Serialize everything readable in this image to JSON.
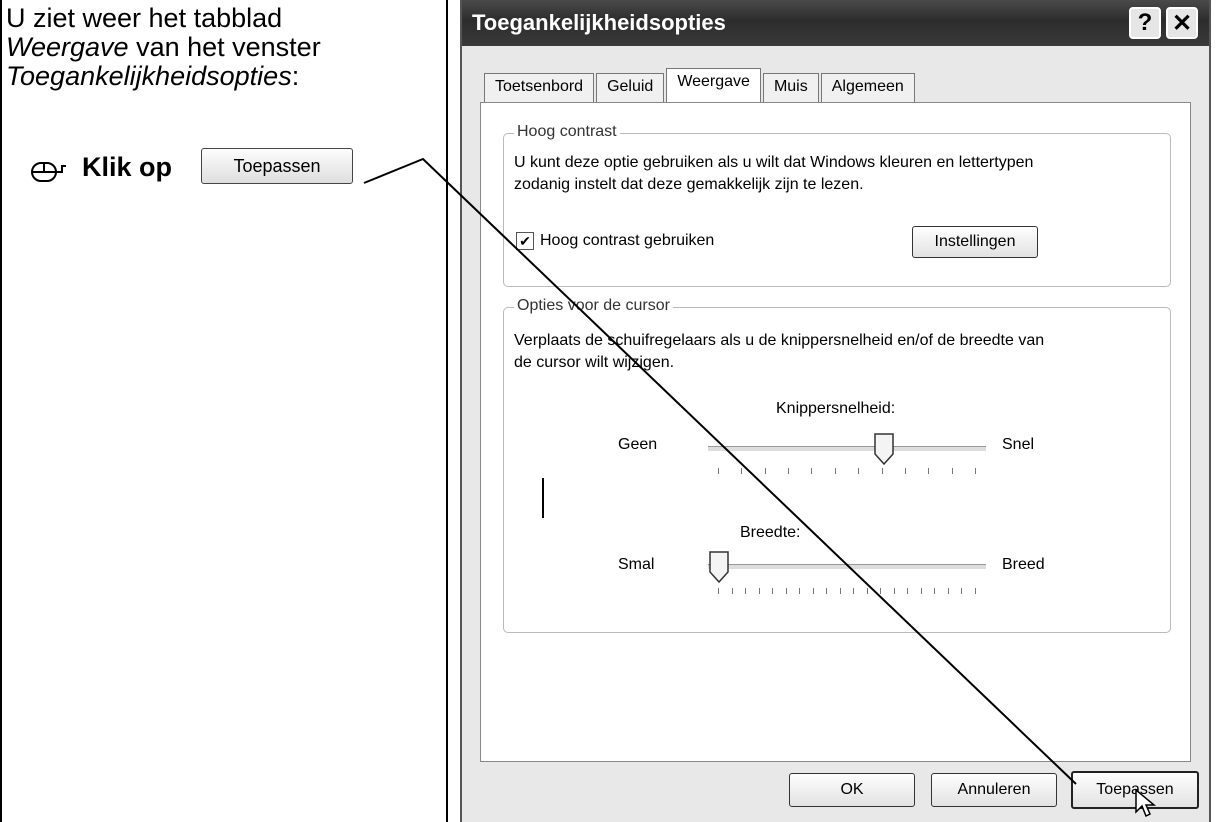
{
  "instruction": {
    "line1": "U ziet weer het tabblad",
    "line2_italic": "Weergave",
    "line2_rest": " van het venster",
    "line3_italic": "Toegankelijkheidsopties",
    "line3_rest": ":",
    "action_label": "Klik op",
    "action_button": "Toepassen"
  },
  "dialog": {
    "title": "Toegankelijkheidsopties",
    "help_glyph": "?",
    "close_glyph": "✕",
    "tabs": [
      "Toetsenbord",
      "Geluid",
      "Weergave",
      "Muis",
      "Algemeen"
    ],
    "active_tab": "Weergave",
    "high_contrast": {
      "legend": "Hoog contrast",
      "desc1": "U kunt deze optie gebruiken als u wilt dat Windows kleuren en lettertypen",
      "desc2": "zodanig instelt dat deze gemakkelijk zijn te lezen.",
      "checkbox_label": "Hoog contrast gebruiken",
      "checked": true,
      "settings_button": "Instellingen"
    },
    "cursor": {
      "legend": "Opties voor de cursor",
      "desc1": "Verplaats de schuifregelaars als u de knippersnelheid en/of de breedte van",
      "desc2": "de cursor wilt wijzigen.",
      "blink_label": "Knippersnelheid:",
      "blink_min": "Geen",
      "blink_max": "Snel",
      "blink_level": 0.64,
      "width_label": "Breedte:",
      "width_min": "Smal",
      "width_max": "Breed",
      "width_level": 0.0
    },
    "buttons": {
      "ok": "OK",
      "cancel": "Annuleren",
      "apply": "Toepassen"
    }
  }
}
